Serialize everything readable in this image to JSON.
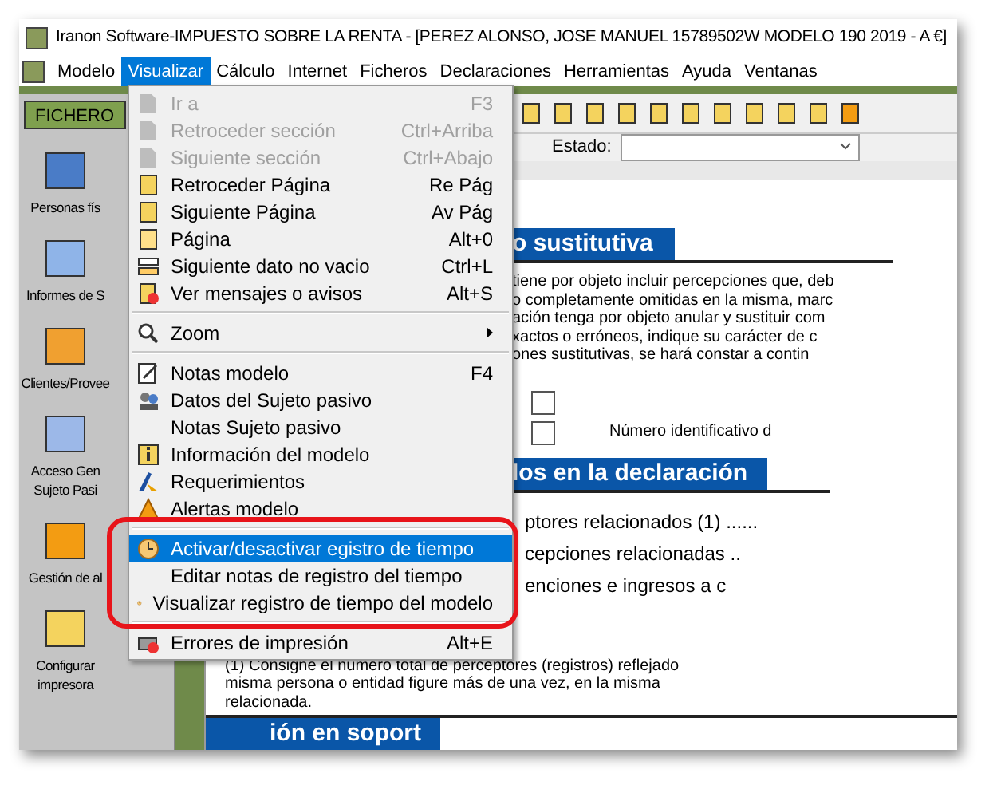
{
  "window": {
    "title": "Iranon Software-IMPUESTO SOBRE LA RENTA - [PEREZ ALONSO, JOSE MANUEL 15789502W  MODELO 190  2019 - A €]"
  },
  "menu_bar": [
    {
      "label": "Modelo",
      "selected": false
    },
    {
      "label": "Visualizar",
      "selected": true
    },
    {
      "label": "Cálculo",
      "selected": false
    },
    {
      "label": "Internet",
      "selected": false
    },
    {
      "label": "Ficheros",
      "selected": false
    },
    {
      "label": "Declaraciones",
      "selected": false
    },
    {
      "label": "Herramientas",
      "selected": false
    },
    {
      "label": "Ayuda",
      "selected": false
    },
    {
      "label": "Ventanas",
      "selected": false
    }
  ],
  "sidebar": {
    "tab": "FICHERO",
    "items": [
      {
        "label": "Personas fís"
      },
      {
        "label": "Informes de S"
      },
      {
        "label": "Clientes/Provee"
      },
      {
        "label": "Acceso Gen\nSujeto Pasi"
      },
      {
        "label": "Gestión de al"
      },
      {
        "label": "Configurar\nimpresora"
      }
    ]
  },
  "estado": {
    "label": "Estado:"
  },
  "menu": [
    {
      "kind": "item",
      "label": "Ir a",
      "shortcut": "F3",
      "disabled": true,
      "selected": false
    },
    {
      "kind": "item",
      "label": "Retroceder sección",
      "shortcut": "Ctrl+Arriba",
      "disabled": true,
      "selected": false
    },
    {
      "kind": "item",
      "label": "Siguiente sección",
      "shortcut": "Ctrl+Abajo",
      "disabled": true,
      "selected": false
    },
    {
      "kind": "item",
      "label": "Retroceder Página",
      "shortcut": "Re Pág",
      "disabled": false,
      "selected": false
    },
    {
      "kind": "item",
      "label": "Siguiente Página",
      "shortcut": "Av Pág",
      "disabled": false,
      "selected": false
    },
    {
      "kind": "item",
      "label": "Página",
      "shortcut": "Alt+0",
      "disabled": false,
      "selected": false
    },
    {
      "kind": "item",
      "label": "Siguiente dato no vacio",
      "shortcut": "Ctrl+L",
      "disabled": false,
      "selected": false
    },
    {
      "kind": "item",
      "label": "Ver mensajes o avisos",
      "shortcut": "Alt+S",
      "disabled": false,
      "selected": false
    },
    {
      "kind": "separator"
    },
    {
      "kind": "submenu",
      "label": "Zoom",
      "disabled": false,
      "selected": false
    },
    {
      "kind": "separator"
    },
    {
      "kind": "item",
      "label": "Notas modelo",
      "shortcut": "F4",
      "disabled": false,
      "selected": false
    },
    {
      "kind": "item",
      "label": "Datos del Sujeto pasivo",
      "disabled": false,
      "selected": false
    },
    {
      "kind": "item",
      "label": "Notas Sujeto pasivo",
      "disabled": false,
      "selected": false
    },
    {
      "kind": "item",
      "label": "Información del modelo",
      "disabled": false,
      "selected": false
    },
    {
      "kind": "item",
      "label": "Requerimientos",
      "disabled": false,
      "selected": false
    },
    {
      "kind": "item",
      "label": "Alertas modelo",
      "disabled": false,
      "selected": false
    },
    {
      "kind": "separator"
    },
    {
      "kind": "item",
      "label": "Activar/desactivar egistro de tiempo",
      "disabled": false,
      "selected": true
    },
    {
      "kind": "item",
      "label": "Editar notas de registro del tiempo",
      "disabled": false,
      "selected": false
    },
    {
      "kind": "item",
      "label": "Visualizar registro de tiempo del modelo",
      "disabled": false,
      "selected": false
    },
    {
      "kind": "separator"
    },
    {
      "kind": "item",
      "label": "Errores de impresión",
      "shortcut": "Alt+E",
      "disabled": false,
      "selected": false
    }
  ],
  "form": {
    "section_1": "o sustitutiva",
    "paragraph_lines": [
      "tiene por objeto incluir percepciones que, deb",
      "o completamente omitidas en la misma, marc",
      "ación tenga por objeto anular y sustituir com",
      "xactos o erróneos, indique su carácter de c",
      "ones sustitutivas, se hará constar a contin"
    ],
    "checkboxes": [
      {
        "checked": false
      },
      {
        "checked": false,
        "label": "Número identificativo d"
      }
    ],
    "section_2": "los en la declaración",
    "summary_lines": [
      "ptores relacionados (1) ......",
      "cepciones relacionadas ..",
      "enciones e ingresos a c"
    ],
    "footnote_lines": [
      "(1) Consigne el número total de perceptores (registros) reflejado",
      "misma persona o entidad figure más de una vez, en la misma",
      "relacionada."
    ],
    "section_3": "ión en soport"
  }
}
